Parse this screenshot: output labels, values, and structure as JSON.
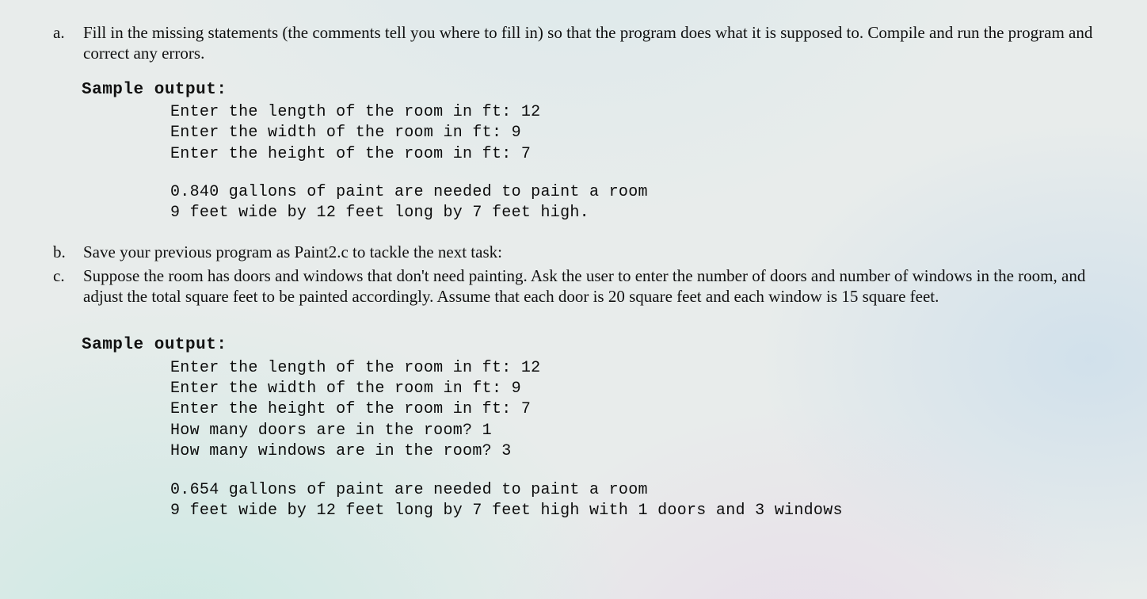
{
  "items": {
    "a": {
      "marker": "a.",
      "text": "Fill in the missing statements (the comments tell you where to fill in) so that the program does what it is supposed to. Compile and run the program and correct any errors."
    },
    "b": {
      "marker": "b.",
      "text": "Save your previous program as Paint2.c to tackle the next task:"
    },
    "c": {
      "marker": "c.",
      "text": "Suppose the room has doors and windows that don't need painting. Ask the user to enter the number of doors and number of windows in the room, and adjust the total square feet to be painted accordingly. Assume that each door is 20 square feet and each window is 15 square feet."
    }
  },
  "sample1": {
    "label": "Sample output:",
    "lines_a": "Enter the length of the room in ft: 12\nEnter the width of the room in ft: 9\nEnter the height of the room in ft: 7",
    "lines_b": "0.840 gallons of paint are needed to paint a room\n9 feet wide by 12 feet long by 7 feet high."
  },
  "sample2": {
    "label": "Sample output:",
    "lines_a": "Enter the length of the room in ft: 12\nEnter the width of the room in ft: 9\nEnter the height of the room in ft: 7\nHow many doors are in the room? 1\nHow many windows are in the room? 3",
    "lines_b": "0.654 gallons of paint are needed to paint a room\n9 feet wide by 12 feet long by 7 feet high with 1 doors and 3 windows"
  }
}
